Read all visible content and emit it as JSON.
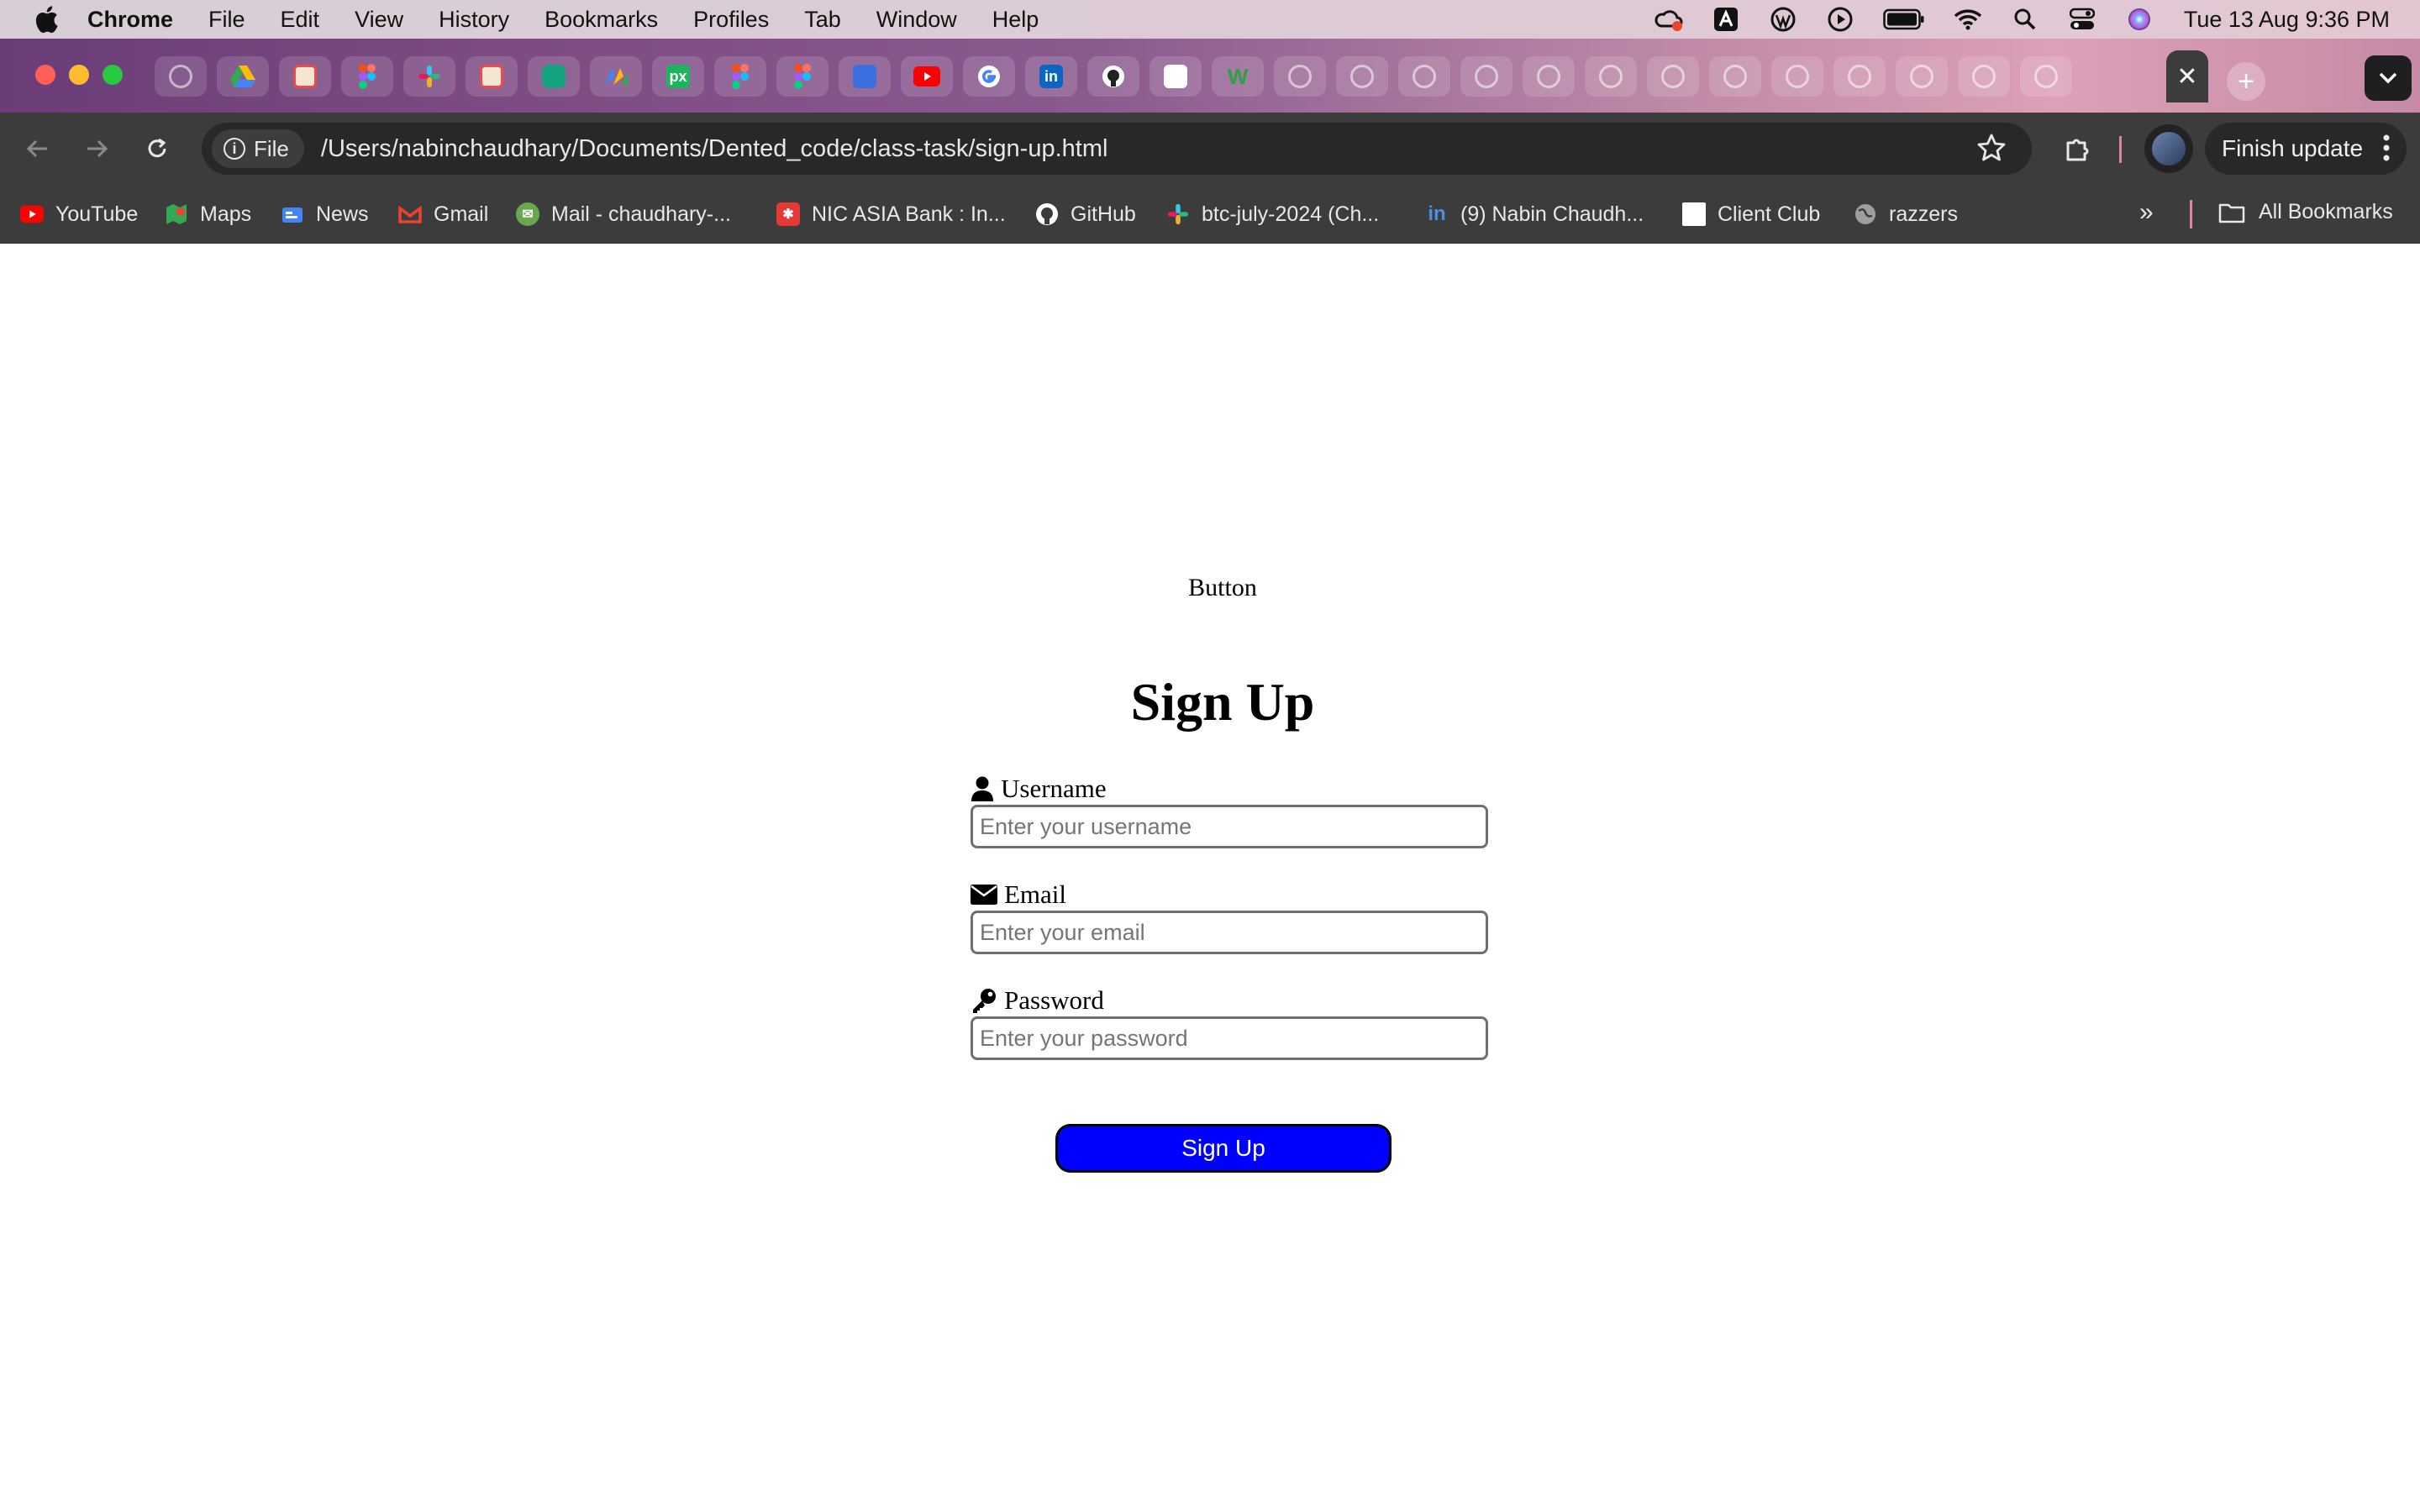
{
  "menubar": {
    "app_name": "Chrome",
    "items": [
      "File",
      "Edit",
      "View",
      "History",
      "Bookmarks",
      "Profiles",
      "Tab",
      "Window",
      "Help"
    ],
    "clock": "Tue 13 Aug  9:36 PM"
  },
  "browser": {
    "chip_label": "File",
    "url": "/Users/nabinchaudhary/Documents/Dented_code/class-task/sign-up.html",
    "finish_update_label": "Finish update",
    "bookmarks": [
      {
        "label": "YouTube",
        "icon": "youtube-icon",
        "color": "#ff0000"
      },
      {
        "label": "Maps",
        "icon": "maps-icon",
        "color": "#34a853"
      },
      {
        "label": "News",
        "icon": "news-icon",
        "color": "#4285f4"
      },
      {
        "label": "Gmail",
        "icon": "gmail-icon",
        "color": "#ea4335"
      },
      {
        "label": "Mail - chaudhary-...",
        "icon": "mail-icon",
        "color": "#6aa84f"
      },
      {
        "label": "NIC ASIA Bank : In...",
        "icon": "nic-asia-icon",
        "color": "#e53935"
      },
      {
        "label": "GitHub",
        "icon": "github-icon",
        "color": "#ffffff"
      },
      {
        "label": "btc-july-2024 (Ch...",
        "icon": "slack-icon",
        "color": "#e01e5a"
      },
      {
        "label": "(9) Nabin Chaudh...",
        "icon": "linkedin-icon",
        "color": "#0a66c2"
      },
      {
        "label": "Client Club",
        "icon": "client-club-icon",
        "color": "#ffffff"
      },
      {
        "label": "razzers",
        "icon": "globe-icon",
        "color": "#9e9e9e"
      }
    ],
    "all_bookmarks_label": "All Bookmarks"
  },
  "page": {
    "top_button_label": "Button",
    "title": "Sign Up",
    "fields": {
      "username": {
        "label": "Username",
        "placeholder": "Enter your username",
        "icon": "user-icon"
      },
      "email": {
        "label": "Email",
        "placeholder": "Enter your email",
        "icon": "envelope-icon"
      },
      "password": {
        "label": "Password",
        "placeholder": "Enter your password",
        "icon": "key-icon"
      }
    },
    "submit_label": "Sign Up",
    "submit_color": "#0000ff"
  }
}
